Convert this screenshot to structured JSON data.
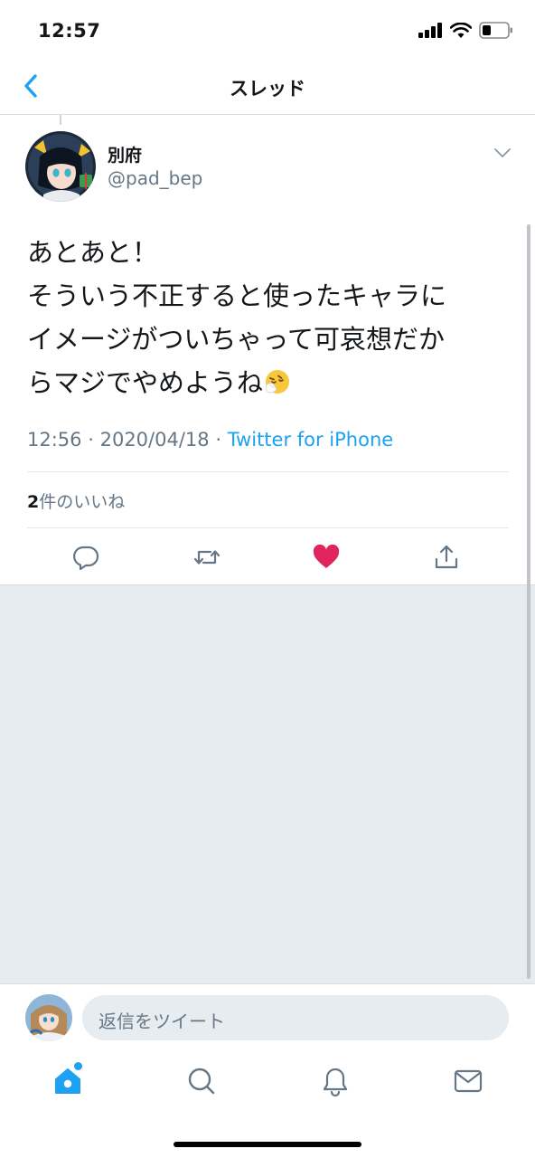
{
  "status_bar": {
    "time": "12:57"
  },
  "nav": {
    "title": "スレッド",
    "back_icon": "chevron-left-icon"
  },
  "tweet": {
    "author_name": "別府",
    "author_handle": "@pad_bep",
    "text_lines": [
      "あとあと！",
      "そういう不正すると使ったキャラに",
      "イメージがついちゃって可哀想だか",
      "らマジでやめようね"
    ],
    "emoji": "🤧",
    "time": "12:56",
    "date": "2020/04/18",
    "separator": "·",
    "source": "Twitter for iPhone",
    "like_count": "2",
    "like_label": "件のいいね",
    "liked": true
  },
  "actions": [
    {
      "name": "reply-icon"
    },
    {
      "name": "retweet-icon"
    },
    {
      "name": "like-icon"
    },
    {
      "name": "share-icon"
    }
  ],
  "reply": {
    "placeholder": "返信をツイート"
  },
  "tabs": [
    {
      "name": "home-icon",
      "active": true
    },
    {
      "name": "search-icon",
      "active": false
    },
    {
      "name": "notifications-icon",
      "active": false
    },
    {
      "name": "messages-icon",
      "active": false
    }
  ],
  "colors": {
    "accent": "#1da1f2",
    "like": "#e0245e",
    "secondary_text": "#657786",
    "background_gray": "#e6ecf0"
  }
}
